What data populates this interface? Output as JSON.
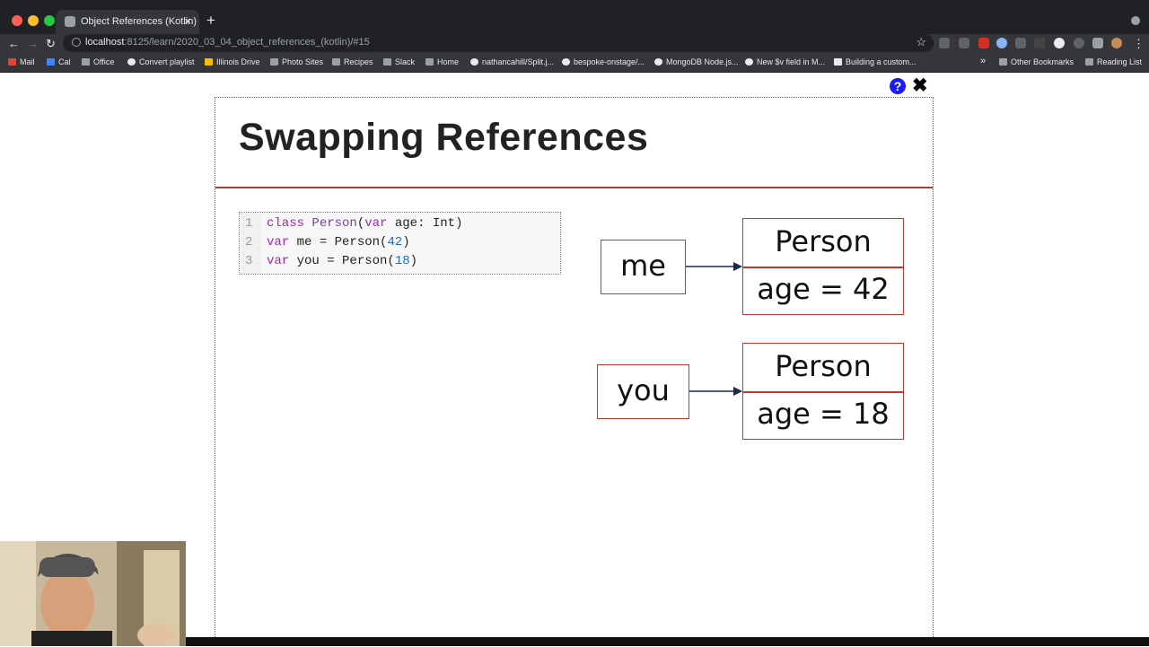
{
  "browser": {
    "tab_title": "Object References (Kotlin)",
    "tab_close": "×",
    "new_tab": "+",
    "url_host": "localhost",
    "url_rest": ":8125/learn/2020_03_04_object_references_(kotlin)/#15",
    "nav": {
      "back": "←",
      "forward": "→",
      "reload": "↻",
      "star": "☆"
    },
    "bookmarks": [
      {
        "label": "Mail",
        "icon": "gmail-icon"
      },
      {
        "label": "Cal",
        "icon": "calendar-icon"
      },
      {
        "label": "Office",
        "icon": "folder-icon"
      },
      {
        "label": "Convert playlist",
        "icon": "site-icon"
      },
      {
        "label": "Illinois Drive",
        "icon": "drive-icon"
      },
      {
        "label": "Photo Sites",
        "icon": "folder-icon"
      },
      {
        "label": "Recipes",
        "icon": "folder-icon"
      },
      {
        "label": "Slack",
        "icon": "folder-icon"
      },
      {
        "label": "Home",
        "icon": "folder-icon"
      },
      {
        "label": "nathancahill/Split.j...",
        "icon": "github-icon"
      },
      {
        "label": "bespoke-onstage/...",
        "icon": "github-icon"
      },
      {
        "label": "MongoDB Node.js...",
        "icon": "site-icon"
      },
      {
        "label": "New $v field in M...",
        "icon": "github-icon"
      },
      {
        "label": "Building a custom...",
        "icon": "site-icon"
      }
    ],
    "overflow": "»",
    "other_bookmarks": "Other Bookmarks",
    "reading_list": "Reading List"
  },
  "slide": {
    "help": "?",
    "close": "✖",
    "title": "Swapping References",
    "code_lines": [
      {
        "num": "1",
        "parts": [
          {
            "t": "class",
            "c": "kw"
          },
          {
            "t": " "
          },
          {
            "t": "Person",
            "c": "cls"
          },
          {
            "t": "("
          },
          {
            "t": "var",
            "c": "kw"
          },
          {
            "t": " age: Int)"
          }
        ]
      },
      {
        "num": "2",
        "parts": [
          {
            "t": "var",
            "c": "kw"
          },
          {
            "t": " me = Person("
          },
          {
            "t": "42",
            "c": "num"
          },
          {
            "t": ")"
          }
        ]
      },
      {
        "num": "3",
        "parts": [
          {
            "t": "var",
            "c": "kw"
          },
          {
            "t": " you = Person("
          },
          {
            "t": "18",
            "c": "num"
          },
          {
            "t": ")"
          }
        ]
      }
    ],
    "diagram": {
      "refs": [
        {
          "name": "me",
          "class": "Person",
          "field": "age = 42"
        },
        {
          "name": "you",
          "class": "Person",
          "field": "age = 18"
        }
      ],
      "colors": {
        "border": "#c0392b",
        "arrow": "#1b2a4a"
      }
    }
  }
}
